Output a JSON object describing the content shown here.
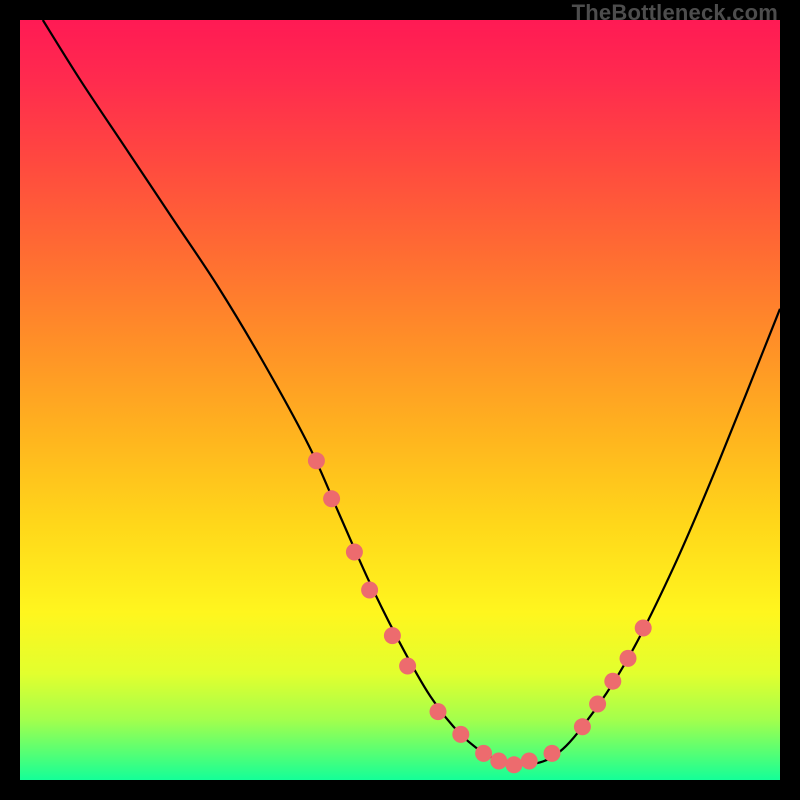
{
  "watermark": "TheBottleneck.com",
  "chart_data": {
    "type": "line",
    "title": "",
    "xlabel": "",
    "ylabel": "",
    "xlim": [
      0,
      100
    ],
    "ylim": [
      0,
      100
    ],
    "grid": false,
    "background_gradient": [
      "#ff1a54",
      "#ffd61a",
      "#14ff98"
    ],
    "series": [
      {
        "name": "bottleneck-curve",
        "x": [
          3,
          8,
          14,
          20,
          26,
          32,
          38,
          42,
          46,
          50,
          54,
          58,
          62,
          66,
          70,
          74,
          80,
          86,
          92,
          100
        ],
        "y": [
          100,
          92,
          83,
          74,
          65,
          55,
          44,
          35,
          26,
          18,
          11,
          6,
          3,
          2,
          3,
          7,
          16,
          28,
          42,
          62
        ]
      }
    ],
    "markers": {
      "name": "highlight-dots",
      "color": "#ed6b6e",
      "x": [
        39,
        41,
        44,
        46,
        49,
        51,
        55,
        58,
        61,
        63,
        65,
        67,
        70,
        74,
        76,
        78,
        80,
        82
      ],
      "y": [
        42,
        37,
        30,
        25,
        19,
        15,
        9,
        6,
        3.5,
        2.5,
        2,
        2.5,
        3.5,
        7,
        10,
        13,
        16,
        20
      ]
    }
  }
}
